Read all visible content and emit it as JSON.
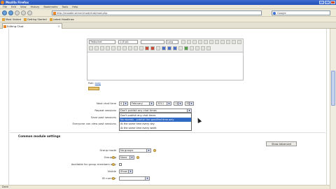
{
  "window": {
    "title": "Mozilla Firefox"
  },
  "menu": [
    "File",
    "Edit",
    "View",
    "History",
    "Bookmarks",
    "Tools",
    "Help"
  ],
  "nav": {
    "url": "http://moodle.server/mod/chat/mod.php",
    "search_placeholder": "Google"
  },
  "bookmarks": [
    "Most Visited",
    "Getting Started",
    "Latest Headlines"
  ],
  "tab": {
    "title": "Editing Chat"
  },
  "editor": {
    "font_select": "Trebuchet",
    "size_select": "1 (8 pt)",
    "lang_select": "Lang",
    "path_label": "Path:",
    "path_link": "body"
  },
  "form": {
    "next_chat_time_label": "Next chat time",
    "day": "4",
    "month": "February",
    "year": "2011",
    "hour": "11",
    "minute": "33",
    "repeat_label": "Repeat sessions",
    "repeat_selected": "Don't publish any chat times",
    "save_past_label": "Save past sessions",
    "everyone_label": "Everyone can view past sessions",
    "repeat_options": [
      "Don't publish any chat times",
      "No repeats - publish the specified time only",
      "At the same time every day",
      "At the same time every week"
    ],
    "highlighted_option_index": 1
  },
  "common_settings": {
    "title": "Common module settings",
    "advanced_button": "Show Advanced",
    "group_mode_label": "Group mode",
    "group_mode_value": "No groups",
    "grouping_label": "Grouping",
    "grouping_value": "None",
    "available_label": "Available for group members only",
    "visible_label": "Visible",
    "visible_value": "Show",
    "id_number_label": "ID number"
  },
  "status": {
    "text": "Done"
  }
}
